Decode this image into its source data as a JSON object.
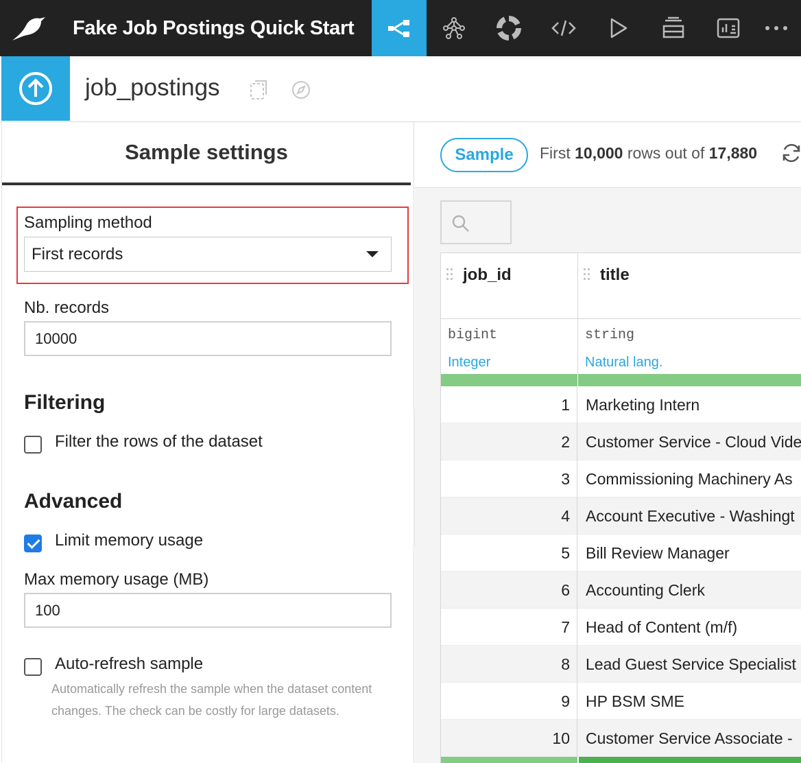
{
  "app": {
    "project_title": "Fake Job Postings Quick Start",
    "nav_icons": [
      "flow-icon",
      "lab-icon",
      "help-ring-icon",
      "code-icon",
      "run-icon",
      "stack-icon",
      "dashboard-icon",
      "more-icon"
    ],
    "accent_color": "#2AA8E0"
  },
  "dataset": {
    "name": "job_postings"
  },
  "left_panel": {
    "tab_title": "Sample settings",
    "sampling_method_label": "Sampling method",
    "sampling_method_value": "First records",
    "nb_records_label": "Nb. records",
    "nb_records_value": "10000",
    "filtering_title": "Filtering",
    "filter_checkbox_label": "Filter the rows of the dataset",
    "filter_checked": false,
    "advanced_title": "Advanced",
    "limit_memory_label": "Limit memory usage",
    "limit_memory_checked": true,
    "max_memory_label": "Max memory usage (MB)",
    "max_memory_value": "100",
    "auto_refresh_label": "Auto-refresh sample",
    "auto_refresh_checked": false,
    "auto_refresh_help": "Automatically refresh the sample when the dataset content changes. The check can be costly for large datasets."
  },
  "right_panel": {
    "sample_pill": "Sample",
    "info_prefix": "First",
    "info_rows": "10,000",
    "info_middle": "rows out of",
    "info_total": "17,880",
    "columns": [
      {
        "name": "job_id",
        "storage_type": "bigint",
        "meaning": "Integer"
      },
      {
        "name": "title",
        "storage_type": "string",
        "meaning": "Natural lang."
      }
    ],
    "rows": [
      {
        "job_id": "1",
        "title": "Marketing Intern"
      },
      {
        "job_id": "2",
        "title": "Customer Service - Cloud Vide"
      },
      {
        "job_id": "3",
        "title": "Commissioning Machinery As"
      },
      {
        "job_id": "4",
        "title": "Account Executive - Washingt"
      },
      {
        "job_id": "5",
        "title": "Bill Review Manager"
      },
      {
        "job_id": "6",
        "title": "Accounting Clerk"
      },
      {
        "job_id": "7",
        "title": "Head of Content (m/f)"
      },
      {
        "job_id": "8",
        "title": "Lead Guest Service Specialist"
      },
      {
        "job_id": "9",
        "title": "HP BSM SME"
      },
      {
        "job_id": "10",
        "title": "Customer Service Associate -"
      }
    ]
  }
}
